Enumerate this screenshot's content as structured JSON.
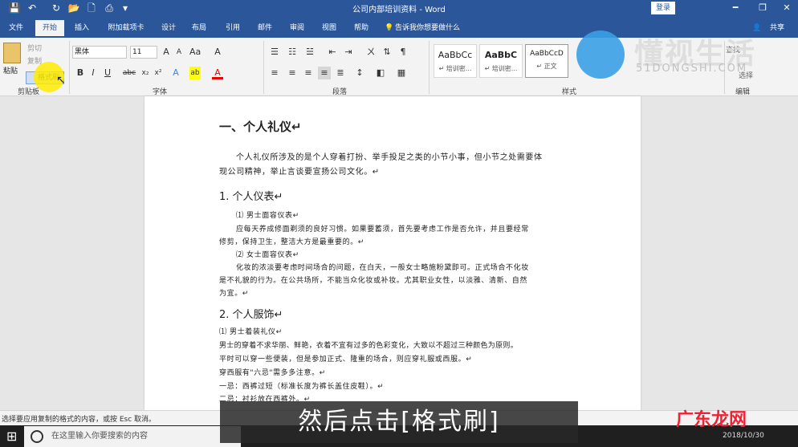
{
  "titlebar": {
    "title": "公司内部培训资料 - Word",
    "login": "登录",
    "minimize": "━",
    "restore": "❐",
    "close": "✕"
  },
  "quick_access": {
    "save": "💾",
    "undo": "↶",
    "redo": "↻",
    "open": "📂",
    "new": "🗋",
    "print": "⎙",
    "more": "▾"
  },
  "tabs": [
    "文件",
    "开始",
    "插入",
    "附加载项卡",
    "设计",
    "布局",
    "引用",
    "邮件",
    "审阅",
    "视图",
    "帮助"
  ],
  "tell_me": "告诉我你想要做什么",
  "share": "共享",
  "clipboard": {
    "paste": "粘贴",
    "cut": "剪切",
    "copy": "复制",
    "format_painter": "格式刷",
    "label": "剪贴板"
  },
  "font": {
    "name": "黑体",
    "size": "11",
    "label": "字体",
    "bold": "B",
    "italic": "I",
    "underline": "U",
    "strike": "abc",
    "sub": "x₂",
    "sup": "x²",
    "grow": "A",
    "shrink": "A",
    "highlight": "ab",
    "color": "A",
    "clear": "A"
  },
  "paragraph": {
    "label": "段落"
  },
  "styles": {
    "label": "样式",
    "items": [
      {
        "preview": "AaBbCc",
        "name": "↵ 培训密..."
      },
      {
        "preview": "AaBbC",
        "name": "↵ 培训密..."
      },
      {
        "preview": "AaBbCcD",
        "name": "↵ 正文"
      }
    ]
  },
  "editing": {
    "label": "编辑",
    "find": "查找",
    "select": "选择"
  },
  "watermark": {
    "text": "懂视生活",
    "sub": "51DONGSHI.COM",
    "corner": "广东龙网"
  },
  "document": {
    "h1": "一、个人礼仪↵",
    "intro": [
      "个人礼仪所涉及的是个人穿着打扮、举手投足之类的小节小事，但小节之处需要体",
      "现公司精神，举止言谈要宣扬公司文化。↵"
    ],
    "h2a": "1. 个人仪表↵",
    "sec1": [
      "⑴ 男士面容仪表↵",
      "应每天养成修面剃须的良好习惯。如果要蓄须，首先要考虑工作是否允许，并且要经常",
      "修剪，保持卫生，整洁大方是最重要的。↵",
      "⑵ 女士面容仪表↵",
      "化妆的浓淡要考虑时间场合的问题，在白天，一般女士略施粉黛即可。正式场合不化妆",
      "是不礼貌的行为。在公共场所，不能当众化妆或补妆。尤其职业女性，以淡雅、清新、自然",
      "为宜。↵"
    ],
    "h2b": "2. 个人服饰↵",
    "sec2": [
      "⑴ 男士着装礼仪↵",
      "男士的穿着不求华丽、鲜艳，衣着不宜有过多的色彩变化，大致以不超过三种颜色为原则。",
      "平时可以穿一些便装，但是参加正式、隆重的场合，则应穿礼服或西服。↵",
      "穿西服有\"六忌\"需多多注意。↵",
      "一忌：西裤过短（标准长度为裤长盖住皮鞋）。↵",
      "二忌：衬衫放在西裤外。↵"
    ]
  },
  "status": {
    "text": "选择要应用复制的格式的内容，或按 Esc 取消。"
  },
  "taskbar": {
    "search": "在这里输入你要搜索的内容",
    "start": "⊞",
    "time": "2018/10/30"
  },
  "subtitle": "然后点击[格式刷]",
  "colors": {
    "accent": "#2b579a",
    "ribbon": "#f3f3f3"
  }
}
